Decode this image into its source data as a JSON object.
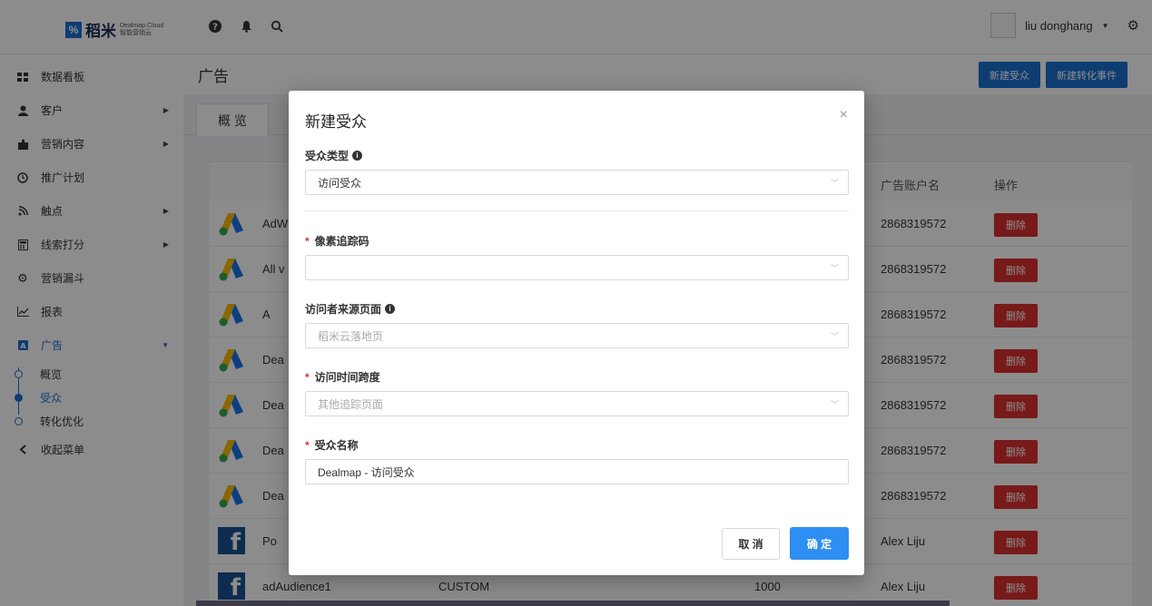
{
  "brand": {
    "mark": "%",
    "name": "稻米",
    "sub_en": "Dealmap.Cloud",
    "sub_cn": "智能营销云"
  },
  "header": {
    "username": "liu donghang",
    "icons": [
      "help-icon",
      "bell-icon",
      "search-icon",
      "gear-icon"
    ]
  },
  "sidebar": {
    "items": [
      {
        "label": "数据看板",
        "icon": "grid-icon"
      },
      {
        "label": "客户",
        "icon": "user-icon"
      },
      {
        "label": "营销内容",
        "icon": "puzzle-icon"
      },
      {
        "label": "推广计划",
        "icon": "clock-icon"
      },
      {
        "label": "触点",
        "icon": "rss-icon"
      },
      {
        "label": "线索打分",
        "icon": "calculator-icon"
      },
      {
        "label": "营销漏斗",
        "icon": "cog-icon"
      },
      {
        "label": "报表",
        "icon": "chart-icon"
      },
      {
        "label": "广告",
        "icon": "ad-icon"
      },
      {
        "label": "收起菜单",
        "icon": "chevron-left-icon"
      }
    ],
    "sub_items": [
      "概览",
      "受众",
      "转化优化"
    ]
  },
  "page": {
    "title": "广告",
    "new_audience_btn": "新建受众",
    "new_conversion_btn": "新建转化事件",
    "tab": "概 览"
  },
  "table": {
    "headers": [
      "广告账户名",
      "操作"
    ],
    "delete_label": "删除",
    "rows": [
      {
        "platform": "adwords",
        "name": "AdW",
        "account": "2868319572"
      },
      {
        "platform": "adwords",
        "name": "All v",
        "account": "2868319572"
      },
      {
        "platform": "adwords",
        "name": "A",
        "account": "2868319572"
      },
      {
        "platform": "adwords",
        "name": "Dea",
        "account": "2868319572"
      },
      {
        "platform": "adwords",
        "name": "Dea",
        "account": "2868319572"
      },
      {
        "platform": "adwords",
        "name": "Dea",
        "account": "2868319572"
      },
      {
        "platform": "adwords",
        "name": "Dea",
        "account": "2868319572"
      },
      {
        "platform": "facebook",
        "name": "Po",
        "account": "Alex Liju"
      },
      {
        "platform": "facebook",
        "name": "adAudience1",
        "type": "CUSTOM",
        "size": "1000",
        "account": "Alex Liju"
      }
    ]
  },
  "modal": {
    "title": "新建受众",
    "close": "×",
    "audience_type_label": "受众类型",
    "audience_type_value": "访问受众",
    "pixel_label": "像素追踪码",
    "pixel_value": "",
    "source_page_label": "访问者来源页面",
    "source_page_placeholder": "稻米云落地页",
    "time_span_label": "访问时间跨度",
    "time_span_placeholder": "其他追踪页面",
    "name_label": "受众名称",
    "name_value": "Dealmap - 访问受众",
    "cancel": "取 消",
    "confirm": "确 定"
  }
}
